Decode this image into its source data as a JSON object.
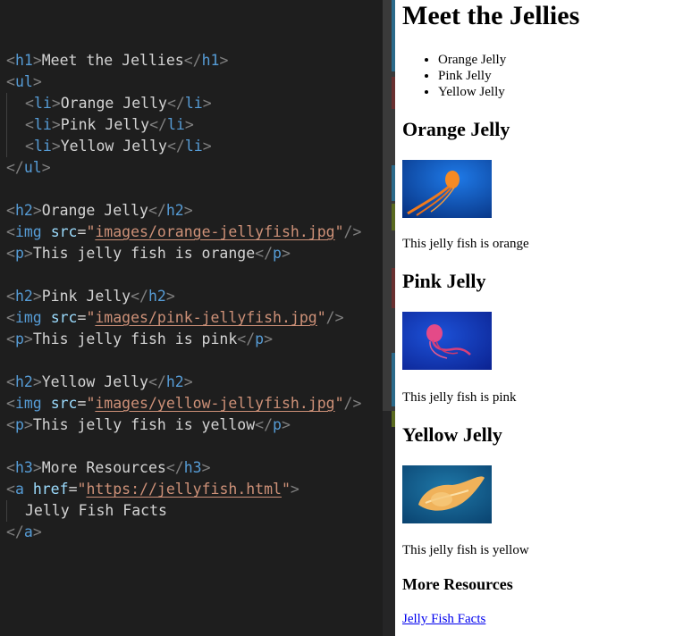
{
  "editor": {
    "lines": [
      [],
      [
        [
          "br",
          "<"
        ],
        [
          "tag",
          "h1"
        ],
        [
          "br",
          ">"
        ],
        [
          "txt",
          "Meet the Jellies"
        ],
        [
          "br",
          "</"
        ],
        [
          "tag",
          "h1"
        ],
        [
          "br",
          ">"
        ]
      ],
      [
        [
          "br",
          "<"
        ],
        [
          "tag",
          "ul"
        ],
        [
          "br",
          ">"
        ]
      ],
      [
        [
          "ind",
          ""
        ],
        [
          "br",
          "<"
        ],
        [
          "tag",
          "li"
        ],
        [
          "br",
          ">"
        ],
        [
          "txt",
          "Orange Jelly"
        ],
        [
          "br",
          "</"
        ],
        [
          "tag",
          "li"
        ],
        [
          "br",
          ">"
        ]
      ],
      [
        [
          "ind",
          ""
        ],
        [
          "br",
          "<"
        ],
        [
          "tag",
          "li"
        ],
        [
          "br",
          ">"
        ],
        [
          "txt",
          "Pink Jelly"
        ],
        [
          "br",
          "</"
        ],
        [
          "tag",
          "li"
        ],
        [
          "br",
          ">"
        ]
      ],
      [
        [
          "ind",
          ""
        ],
        [
          "br",
          "<"
        ],
        [
          "tag",
          "li"
        ],
        [
          "br",
          ">"
        ],
        [
          "txt",
          "Yellow Jelly"
        ],
        [
          "br",
          "</"
        ],
        [
          "tag",
          "li"
        ],
        [
          "br",
          ">"
        ]
      ],
      [
        [
          "br",
          "</"
        ],
        [
          "tag",
          "ul"
        ],
        [
          "br",
          ">"
        ]
      ],
      [],
      [
        [
          "br",
          "<"
        ],
        [
          "tag",
          "h2"
        ],
        [
          "br",
          ">"
        ],
        [
          "txt",
          "Orange Jelly"
        ],
        [
          "br",
          "</"
        ],
        [
          "tag",
          "h2"
        ],
        [
          "br",
          ">"
        ]
      ],
      [
        [
          "br",
          "<"
        ],
        [
          "tag",
          "img"
        ],
        [
          "txt",
          " "
        ],
        [
          "attr",
          "src"
        ],
        [
          "txt",
          "="
        ],
        [
          "str",
          "\""
        ],
        [
          "url",
          "images/orange-jellyfish.jpg"
        ],
        [
          "str",
          "\""
        ],
        [
          "br",
          "/>"
        ]
      ],
      [
        [
          "br",
          "<"
        ],
        [
          "tag",
          "p"
        ],
        [
          "br",
          ">"
        ],
        [
          "txt",
          "This jelly fish is orange"
        ],
        [
          "br",
          "</"
        ],
        [
          "tag",
          "p"
        ],
        [
          "br",
          ">"
        ]
      ],
      [],
      [
        [
          "br",
          "<"
        ],
        [
          "tag",
          "h2"
        ],
        [
          "br",
          ">"
        ],
        [
          "txt",
          "Pink Jelly"
        ],
        [
          "br",
          "</"
        ],
        [
          "tag",
          "h2"
        ],
        [
          "br",
          ">"
        ]
      ],
      [
        [
          "br",
          "<"
        ],
        [
          "tag",
          "img"
        ],
        [
          "txt",
          " "
        ],
        [
          "attr",
          "src"
        ],
        [
          "txt",
          "="
        ],
        [
          "str",
          "\""
        ],
        [
          "url",
          "images/pink-jellyfish.jpg"
        ],
        [
          "str",
          "\""
        ],
        [
          "br",
          "/>"
        ]
      ],
      [
        [
          "br",
          "<"
        ],
        [
          "tag",
          "p"
        ],
        [
          "br",
          ">"
        ],
        [
          "txt",
          "This jelly fish is pink"
        ],
        [
          "br",
          "</"
        ],
        [
          "tag",
          "p"
        ],
        [
          "br",
          ">"
        ]
      ],
      [],
      [
        [
          "br",
          "<"
        ],
        [
          "tag",
          "h2"
        ],
        [
          "br",
          ">"
        ],
        [
          "txt",
          "Yellow Jelly"
        ],
        [
          "br",
          "</"
        ],
        [
          "tag",
          "h2"
        ],
        [
          "br",
          ">"
        ]
      ],
      [
        [
          "br",
          "<"
        ],
        [
          "tag",
          "img"
        ],
        [
          "txt",
          " "
        ],
        [
          "attr",
          "src"
        ],
        [
          "txt",
          "="
        ],
        [
          "str",
          "\""
        ],
        [
          "url",
          "images/yellow-jellyfish.jpg"
        ],
        [
          "str",
          "\""
        ],
        [
          "br",
          "/>"
        ]
      ],
      [
        [
          "br",
          "<"
        ],
        [
          "tag",
          "p"
        ],
        [
          "br",
          ">"
        ],
        [
          "txt",
          "This jelly fish is yellow"
        ],
        [
          "br",
          "</"
        ],
        [
          "tag",
          "p"
        ],
        [
          "br",
          ">"
        ]
      ],
      [],
      [
        [
          "br",
          "<"
        ],
        [
          "tag",
          "h3"
        ],
        [
          "br",
          ">"
        ],
        [
          "txt",
          "More Resources"
        ],
        [
          "br",
          "</"
        ],
        [
          "tag",
          "h3"
        ],
        [
          "br",
          ">"
        ]
      ],
      [
        [
          "br",
          "<"
        ],
        [
          "tag",
          "a"
        ],
        [
          "txt",
          " "
        ],
        [
          "attr",
          "href"
        ],
        [
          "txt",
          "="
        ],
        [
          "str",
          "\""
        ],
        [
          "url",
          "https://jellyfish.html"
        ],
        [
          "str",
          "\""
        ],
        [
          "br",
          ">"
        ]
      ],
      [
        [
          "ind",
          ""
        ],
        [
          "txt",
          "Jelly Fish Facts"
        ]
      ],
      [
        [
          "br",
          "</"
        ],
        [
          "tag",
          "a"
        ],
        [
          "br",
          ">"
        ]
      ]
    ]
  },
  "preview": {
    "title": "Meet the Jellies",
    "list": [
      "Orange Jelly",
      "Pink Jelly",
      "Yellow Jelly"
    ],
    "sections": [
      {
        "heading": "Orange Jelly",
        "caption": "This jelly fish is orange",
        "jelly_color": "#f07a1c",
        "water_color": "#0a4fc0"
      },
      {
        "heading": "Pink Jelly",
        "caption": "This jelly fish is pink",
        "jelly_color": "#e0407a",
        "water_color": "#0b35b8"
      },
      {
        "heading": "Yellow Jelly",
        "caption": "This jelly fish is yellow",
        "jelly_color": "#f2b356",
        "water_color": "#0a5a8a"
      }
    ],
    "resources_heading": "More Resources",
    "link_text": "Jelly Fish Facts"
  },
  "colors": {
    "editor_bg": "#1e1e1e",
    "tag": "#569cd6",
    "bracket": "#808080",
    "attribute": "#9cdcfe",
    "string": "#ce9178",
    "text": "#d4d4d4",
    "link": "#0000ee"
  }
}
